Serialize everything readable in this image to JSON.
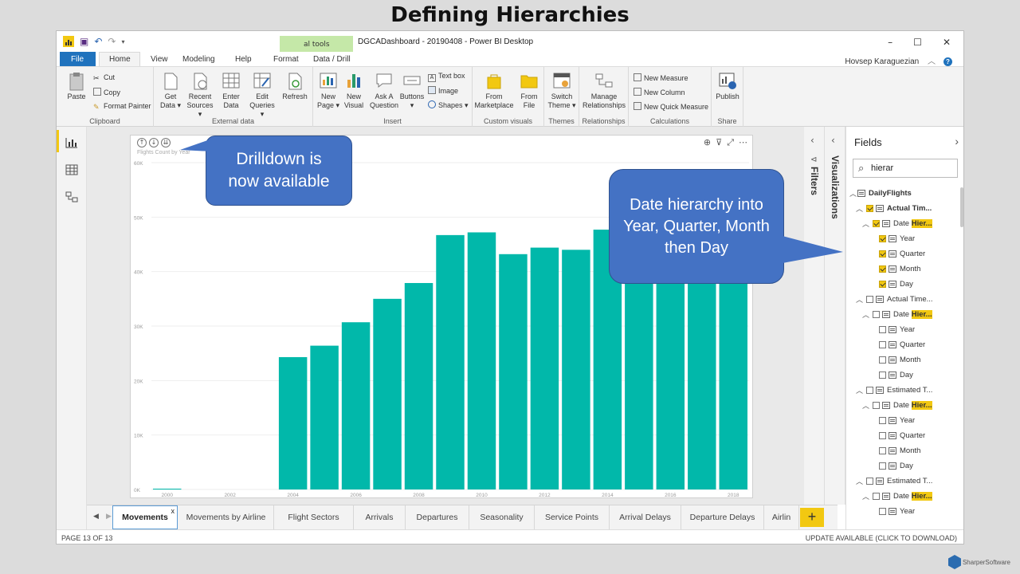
{
  "slide": {
    "title": "Defining Hierarchies",
    "brand": "SharperSoftware"
  },
  "window": {
    "title": "DGCADashboard - 20190408 - Power BI Desktop",
    "context_tab": "al tools",
    "user": "Hovsep Karaguezian"
  },
  "menu": {
    "file": "File",
    "home": "Home",
    "view": "View",
    "modeling": "Modeling",
    "help": "Help",
    "format": "Format",
    "data_drill": "Data / Drill"
  },
  "ribbon": {
    "clipboard": {
      "label": "Clipboard",
      "paste": "Paste",
      "cut": "Cut",
      "copy": "Copy",
      "format_painter": "Format Painter"
    },
    "external": {
      "label": "External data",
      "get_data": "Get Data ▾",
      "recent_sources": "Recent Sources ▾",
      "enter_data": "Enter Data",
      "edit_queries": "Edit Queries ▾",
      "refresh": "Refresh"
    },
    "insert": {
      "label": "Insert",
      "new_page": "New Page ▾",
      "new_visual": "New Visual",
      "ask_question": "Ask A Question",
      "buttons": "Buttons ▾",
      "text_box": "Text box",
      "image": "Image",
      "shapes": "Shapes ▾"
    },
    "custom": {
      "label": "Custom visuals",
      "from_marketplace": "From Marketplace",
      "from_file": "From File"
    },
    "themes": {
      "label": "Themes",
      "switch_theme": "Switch Theme ▾"
    },
    "relationships": {
      "label": "Relationships",
      "manage": "Manage Relationships"
    },
    "calculations": {
      "label": "Calculations",
      "new_measure": "New Measure",
      "new_column": "New Column",
      "new_quick_measure": "New Quick Measure"
    },
    "share": {
      "label": "Share",
      "publish": "Publish"
    }
  },
  "visual": {
    "title": "Flights Count by Year"
  },
  "callouts": {
    "drilldown": "Drilldown is now available",
    "hierarchy": "Date hierarchy into Year, Quarter, Month then Day"
  },
  "chart_data": {
    "type": "bar",
    "categories": [
      2000,
      2001,
      2002,
      2003,
      2004,
      2005,
      2006,
      2007,
      2008,
      2009,
      2010,
      2011,
      2012,
      2013,
      2014,
      2015,
      2016,
      2017,
      2018
    ],
    "values": [
      150,
      0,
      0,
      0,
      24300,
      26400,
      30700,
      35000,
      37900,
      46700,
      47200,
      43200,
      44400,
      44000,
      47700,
      48000,
      48200,
      48100,
      48300
    ],
    "x_tick_labels": [
      "2000",
      "2002",
      "2004",
      "2006",
      "2008",
      "2010",
      "2012",
      "2014",
      "2016",
      "2018"
    ],
    "y_tick_labels": [
      "0K",
      "10K",
      "20K",
      "30K",
      "40K",
      "50K",
      "60K"
    ],
    "ylim": [
      0,
      60000
    ],
    "color": "#01b8aa"
  },
  "tabs": [
    "Movements",
    "Movements by Airline",
    "Flight Sectors",
    "Arrivals",
    "Departures",
    "Seasonality",
    "Service Points",
    "Arrival Delays",
    "Departure Delays",
    "Airlin"
  ],
  "tab_close": "x",
  "status": {
    "page": "PAGE 13 OF 13",
    "update": "UPDATE AVAILABLE (CLICK TO DOWNLOAD)"
  },
  "panes": {
    "filters": "Filters",
    "visualizations": "Visualizations"
  },
  "fields": {
    "title": "Fields",
    "search": "hierar",
    "table": "DailyFlights",
    "groups": [
      {
        "name": "Actual Tim...",
        "checked": true,
        "hier_prefix": "Date",
        "hier_match": "Hier...",
        "levels": [
          "Year",
          "Quarter",
          "Month",
          "Day"
        ]
      },
      {
        "name": "Actual Time...",
        "checked": false,
        "hier_prefix": "Date",
        "hier_match": "Hier...",
        "levels": [
          "Year",
          "Quarter",
          "Month",
          "Day"
        ]
      },
      {
        "name": "Estimated T...",
        "checked": false,
        "hier_prefix": "Date",
        "hier_match": "Hier...",
        "levels": [
          "Year",
          "Quarter",
          "Month",
          "Day"
        ]
      },
      {
        "name": "Estimated T...",
        "checked": false,
        "hier_prefix": "Date",
        "hier_match": "Hier...",
        "levels": [
          "Year"
        ]
      }
    ]
  }
}
